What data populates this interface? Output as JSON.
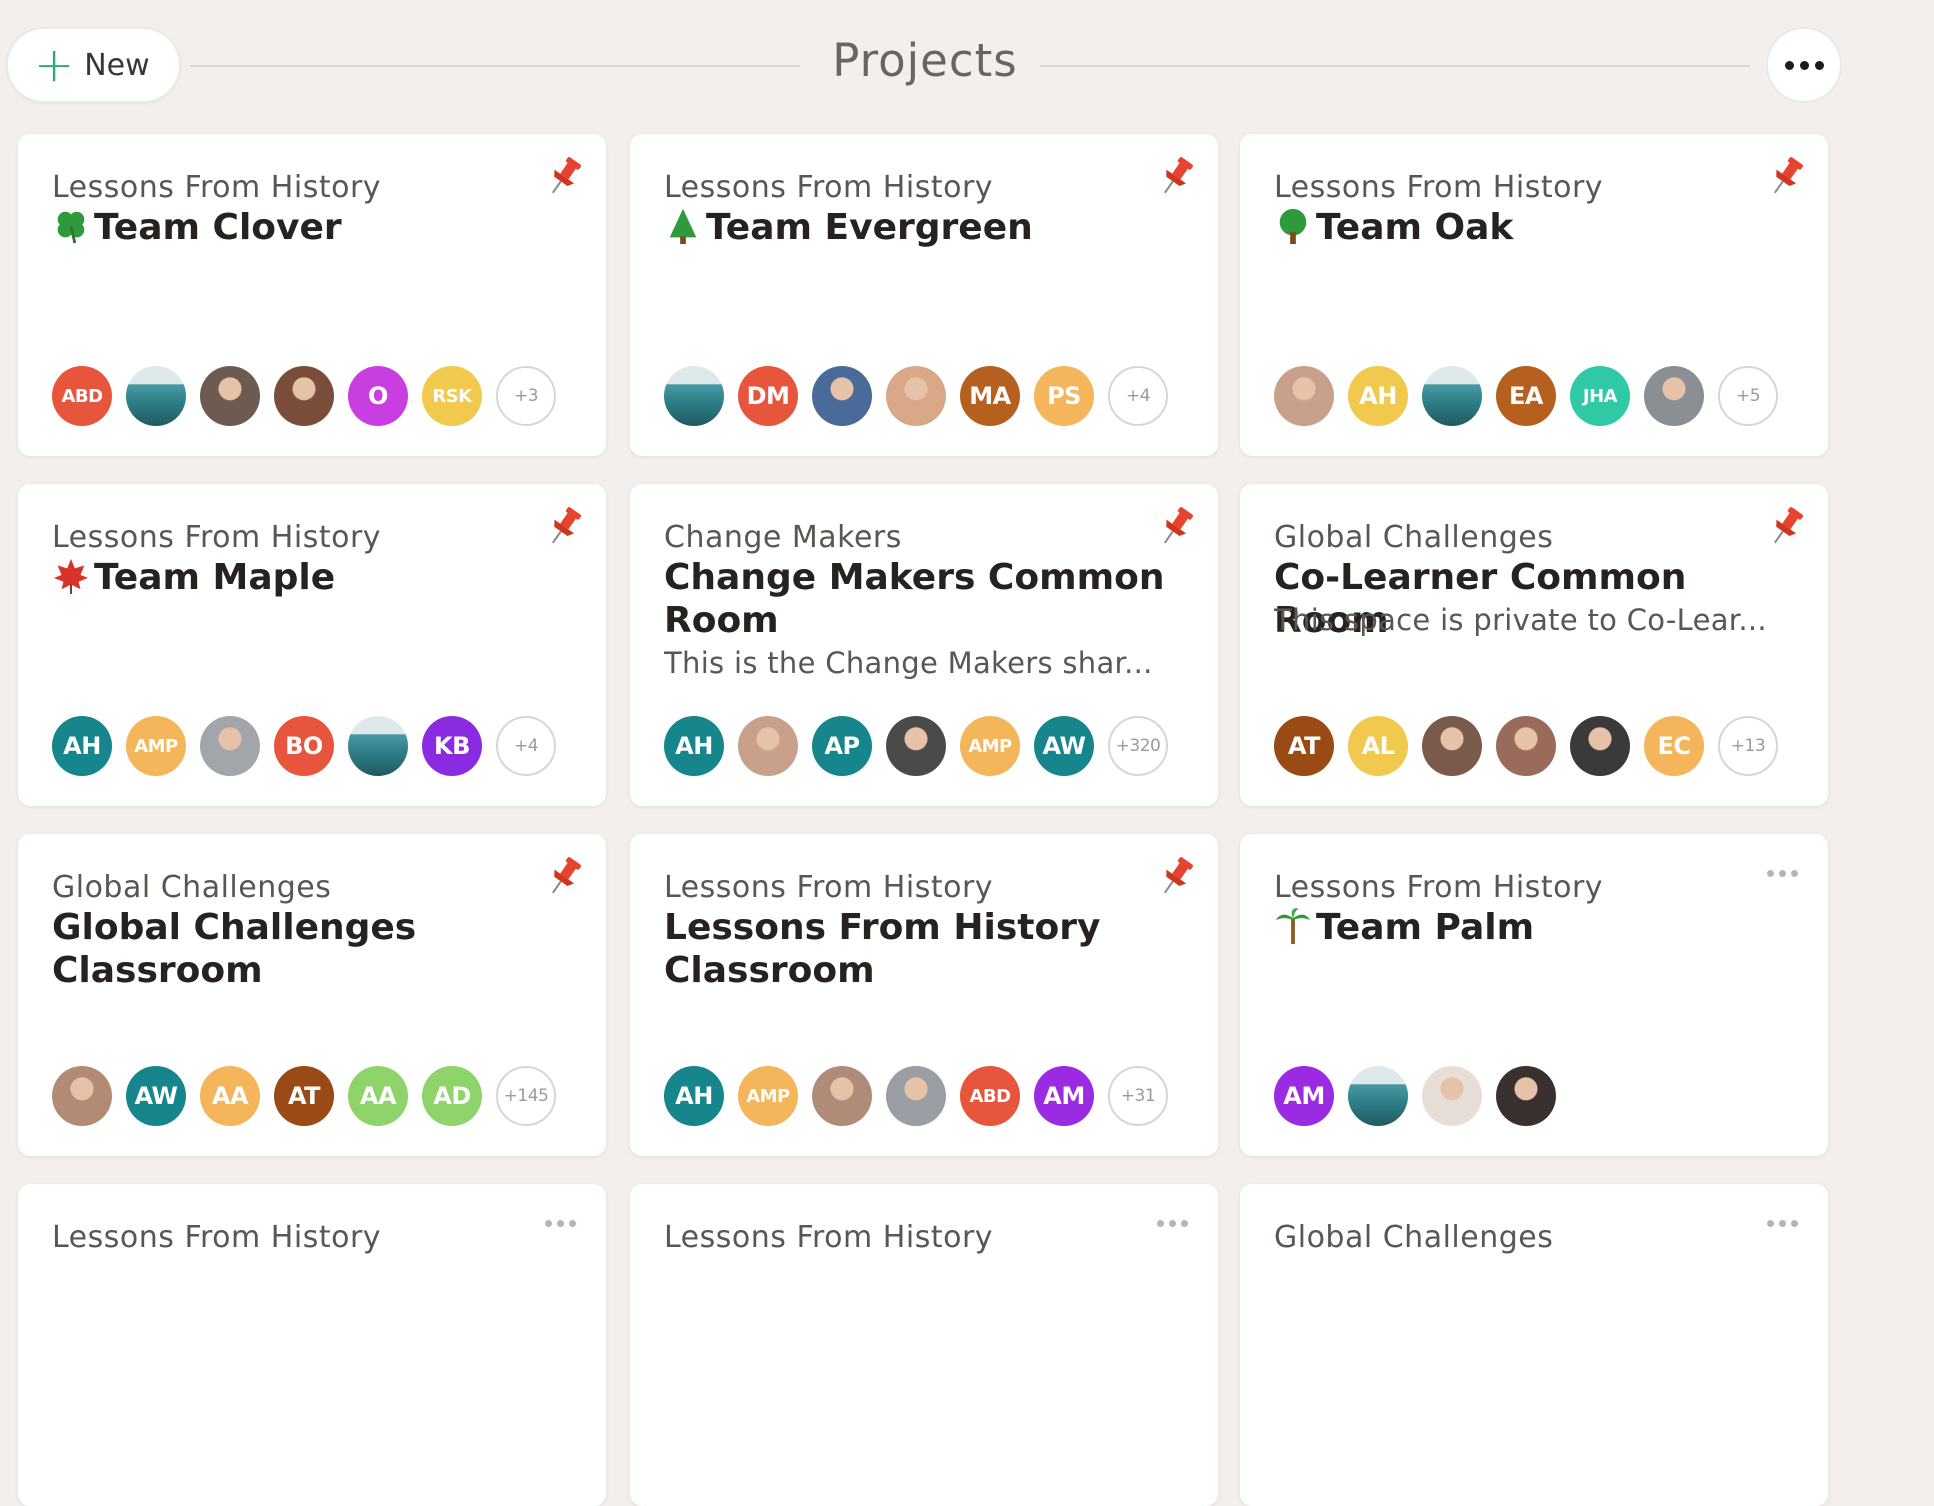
{
  "header": {
    "new_label": "New",
    "title": "Projects"
  },
  "colors": {
    "accent_green": "#2ea86c",
    "pin_red": "#e8432e"
  },
  "cards": [
    {
      "category": "Lessons From History",
      "title": "Team Clover",
      "emoji": "clover-icon",
      "desc": "",
      "marker": "pin",
      "avatars": [
        {
          "t": "ABD",
          "c": "#e8553d",
          "k": "init"
        },
        {
          "k": "landscape"
        },
        {
          "k": "photo",
          "c": "#6d5a50"
        },
        {
          "k": "photo",
          "c": "#7a4e3a"
        },
        {
          "t": "O",
          "c": "#c93ee0",
          "k": "init"
        },
        {
          "t": "RSK",
          "c": "#f0c94e",
          "k": "init"
        }
      ],
      "more": "+3"
    },
    {
      "category": "Lessons From History",
      "title": "Team Evergreen",
      "emoji": "evergreen-tree-icon",
      "desc": "",
      "marker": "pin",
      "avatars": [
        {
          "k": "landscape"
        },
        {
          "t": "DM",
          "c": "#e8553d",
          "k": "init"
        },
        {
          "k": "photo",
          "c": "#4a6a9a"
        },
        {
          "k": "photo",
          "c": "#d9a888"
        },
        {
          "t": "MA",
          "c": "#b5601f",
          "k": "init"
        },
        {
          "t": "PS",
          "c": "#f5b55a",
          "k": "init"
        }
      ],
      "more": "+4"
    },
    {
      "category": "Lessons From History",
      "title": "Team Oak",
      "emoji": "oak-tree-icon",
      "desc": "",
      "marker": "pin",
      "avatars": [
        {
          "k": "photo",
          "c": "#c9a18a"
        },
        {
          "t": "AH",
          "c": "#f0c94e",
          "k": "init"
        },
        {
          "k": "landscape"
        },
        {
          "t": "EA",
          "c": "#b5601f",
          "k": "init"
        },
        {
          "t": "JHA",
          "c": "#2fc9a5",
          "k": "init"
        },
        {
          "k": "photo",
          "c": "#8a8f94"
        }
      ],
      "more": "+5"
    },
    {
      "category": "Lessons From History",
      "title": "Team Maple",
      "emoji": "maple-leaf-icon",
      "desc": "",
      "marker": "pin",
      "avatars": [
        {
          "t": "AH",
          "c": "#16858c",
          "k": "init"
        },
        {
          "t": "AMP",
          "c": "#f5b55a",
          "k": "init"
        },
        {
          "k": "photo",
          "c": "#a2a6ab"
        },
        {
          "t": "BO",
          "c": "#e8553d",
          "k": "init"
        },
        {
          "k": "landscape"
        },
        {
          "t": "KB",
          "c": "#8a2be2",
          "k": "init"
        }
      ],
      "more": "+4"
    },
    {
      "category": "Change Makers",
      "title": "Change Makers Common Room",
      "emoji": "",
      "desc": "This is the Change Makers shar...",
      "marker": "pin",
      "avatars": [
        {
          "t": "AH",
          "c": "#16858c",
          "k": "init"
        },
        {
          "k": "photo",
          "c": "#c9a18a"
        },
        {
          "t": "AP",
          "c": "#16858c",
          "k": "init"
        },
        {
          "k": "photo",
          "c": "#4a4a4a"
        },
        {
          "t": "AMP",
          "c": "#f5b55a",
          "k": "init"
        },
        {
          "t": "AW",
          "c": "#16858c",
          "k": "init"
        }
      ],
      "more": "+320"
    },
    {
      "category": "Global Challenges",
      "title": "Co-Learner Common Room",
      "emoji": "",
      "desc": "This space is private to Co-Lear...",
      "marker": "pin",
      "avatars": [
        {
          "t": "AT",
          "c": "#9a4a14",
          "k": "init"
        },
        {
          "t": "AL",
          "c": "#f0c94e",
          "k": "init"
        },
        {
          "k": "photo",
          "c": "#7a5a4a"
        },
        {
          "k": "photo",
          "c": "#9a6a5a"
        },
        {
          "k": "photo",
          "c": "#3a3a3a"
        },
        {
          "t": "EC",
          "c": "#f5b55a",
          "k": "init"
        }
      ],
      "more": "+13"
    },
    {
      "category": "Global Challenges",
      "title": "Global Challenges Classroom",
      "emoji": "",
      "desc": "",
      "marker": "pin",
      "avatars": [
        {
          "k": "photo",
          "c": "#b38a74"
        },
        {
          "t": "AW",
          "c": "#16858c",
          "k": "init"
        },
        {
          "t": "AA",
          "c": "#f5b55a",
          "k": "init"
        },
        {
          "t": "AT",
          "c": "#9a4a14",
          "k": "init"
        },
        {
          "t": "AA",
          "c": "#8fd36b",
          "k": "init"
        },
        {
          "t": "AD",
          "c": "#8fd36b",
          "k": "init"
        }
      ],
      "more": "+145"
    },
    {
      "category": "Lessons From History",
      "title": "Lessons From History Classroom",
      "emoji": "",
      "desc": "",
      "marker": "pin",
      "avatars": [
        {
          "t": "AH",
          "c": "#16858c",
          "k": "init"
        },
        {
          "t": "AMP",
          "c": "#f5b55a",
          "k": "init"
        },
        {
          "k": "photo",
          "c": "#b08c78"
        },
        {
          "k": "photo",
          "c": "#9a9ea4"
        },
        {
          "t": "ABD",
          "c": "#e8553d",
          "k": "init"
        },
        {
          "t": "AM",
          "c": "#9a2be2",
          "k": "init"
        }
      ],
      "more": "+31"
    },
    {
      "category": "Lessons From History",
      "title": "Team Palm",
      "emoji": "palm-tree-icon",
      "desc": "",
      "marker": "dots",
      "avatars": [
        {
          "t": "AM",
          "c": "#9a2be2",
          "k": "init"
        },
        {
          "k": "landscape"
        },
        {
          "k": "photo",
          "c": "#e8ded8"
        },
        {
          "k": "photo",
          "c": "#3a3030"
        }
      ],
      "more": ""
    },
    {
      "category": "Lessons From History",
      "title": "",
      "emoji": "",
      "desc": "",
      "marker": "dots",
      "avatars": [],
      "more": ""
    },
    {
      "category": "Lessons From History",
      "title": "",
      "emoji": "",
      "desc": "",
      "marker": "dots",
      "avatars": [],
      "more": ""
    },
    {
      "category": "Global Challenges",
      "title": "",
      "emoji": "",
      "desc": "",
      "marker": "dots",
      "avatars": [],
      "more": ""
    }
  ]
}
